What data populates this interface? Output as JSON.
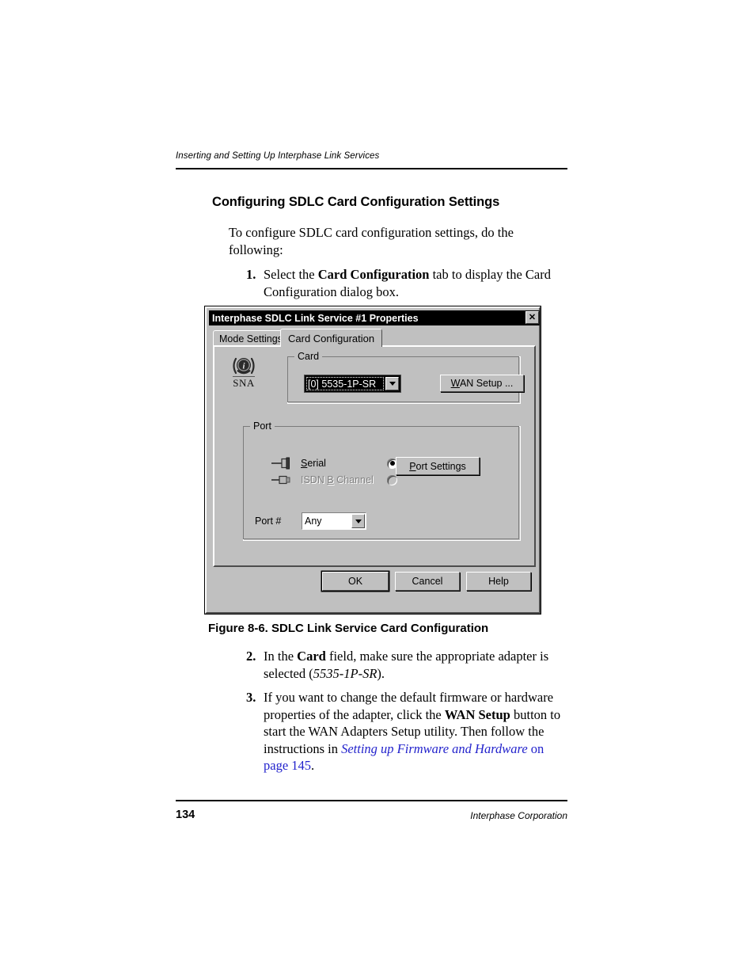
{
  "page": {
    "running_head": "Inserting and Setting Up Interphase Link Services",
    "heading": "Configuring SDLC Card Configuration Settings",
    "intro": "To configure SDLC card configuration settings, do the following:",
    "figure_caption": "Figure 8-6.  SDLC Link Service Card Configuration",
    "footer": {
      "page_number": "134",
      "corporation": "Interphase Corporation"
    },
    "steps": [
      {
        "number": "1.",
        "segments": [
          {
            "text": "Select the ",
            "style": "normal"
          },
          {
            "text": "Card Configuration",
            "style": "bold"
          },
          {
            "text": " tab to display the Card Configuration dialog box.",
            "style": "normal"
          }
        ]
      },
      {
        "number": "2.",
        "segments": [
          {
            "text": "In the ",
            "style": "normal"
          },
          {
            "text": "Card",
            "style": "bold"
          },
          {
            "text": " field, make sure the appropriate adapter is selected (",
            "style": "normal"
          },
          {
            "text": "5535-1P-SR",
            "style": "italic"
          },
          {
            "text": ").",
            "style": "normal"
          }
        ]
      },
      {
        "number": "3.",
        "segments": [
          {
            "text": "If you want to change the default firmware or hardware properties of the adapter, click the ",
            "style": "normal"
          },
          {
            "text": "WAN Setup",
            "style": "bold"
          },
          {
            "text": " button to start the WAN Adapters Setup utility. Then follow the instructions in ",
            "style": "normal"
          },
          {
            "text": "Setting up Firmware and Hardware",
            "style": "link-italic"
          },
          {
            "text": " ",
            "style": "normal"
          },
          {
            "text": "on page 145",
            "style": "link"
          },
          {
            "text": ".",
            "style": "normal"
          }
        ]
      }
    ]
  },
  "dialog": {
    "title": "Interphase SDLC Link Service #1 Properties",
    "close_label": "✕",
    "tabs": [
      {
        "label": "Mode Settings",
        "active": false
      },
      {
        "label": "Card Configuration",
        "active": true
      }
    ],
    "sna_icon_label": "SNA",
    "card_group": {
      "legend": "Card",
      "selected_card": "[0] 5535-1P-SR",
      "wan_setup_button": {
        "accel": "W",
        "rest": "AN Setup ..."
      }
    },
    "port_group": {
      "legend": "Port",
      "options": [
        {
          "label_accel": "S",
          "label_rest": "erial",
          "label_full": "Serial",
          "selected": true,
          "disabled": false,
          "icon": "serial-connector-icon"
        },
        {
          "label_pre": "ISDN ",
          "label_accel": "B",
          "label_rest": " Channel",
          "label_full": "ISDN B Channel",
          "selected": false,
          "disabled": true,
          "icon": "isdn-connector-icon"
        }
      ],
      "port_settings_button": {
        "accel": "P",
        "rest": "ort Settings"
      },
      "port_number_label": "Port #",
      "port_number_value": "Any"
    },
    "buttons": [
      {
        "label": "OK",
        "default": true
      },
      {
        "label": "Cancel",
        "default": false
      },
      {
        "label": "Help",
        "default": false
      }
    ]
  },
  "colors": {
    "dialog_face": "#c0c0c0",
    "titlebar": "#000000",
    "link": "#2222cc",
    "disabled_text": "#808080"
  }
}
